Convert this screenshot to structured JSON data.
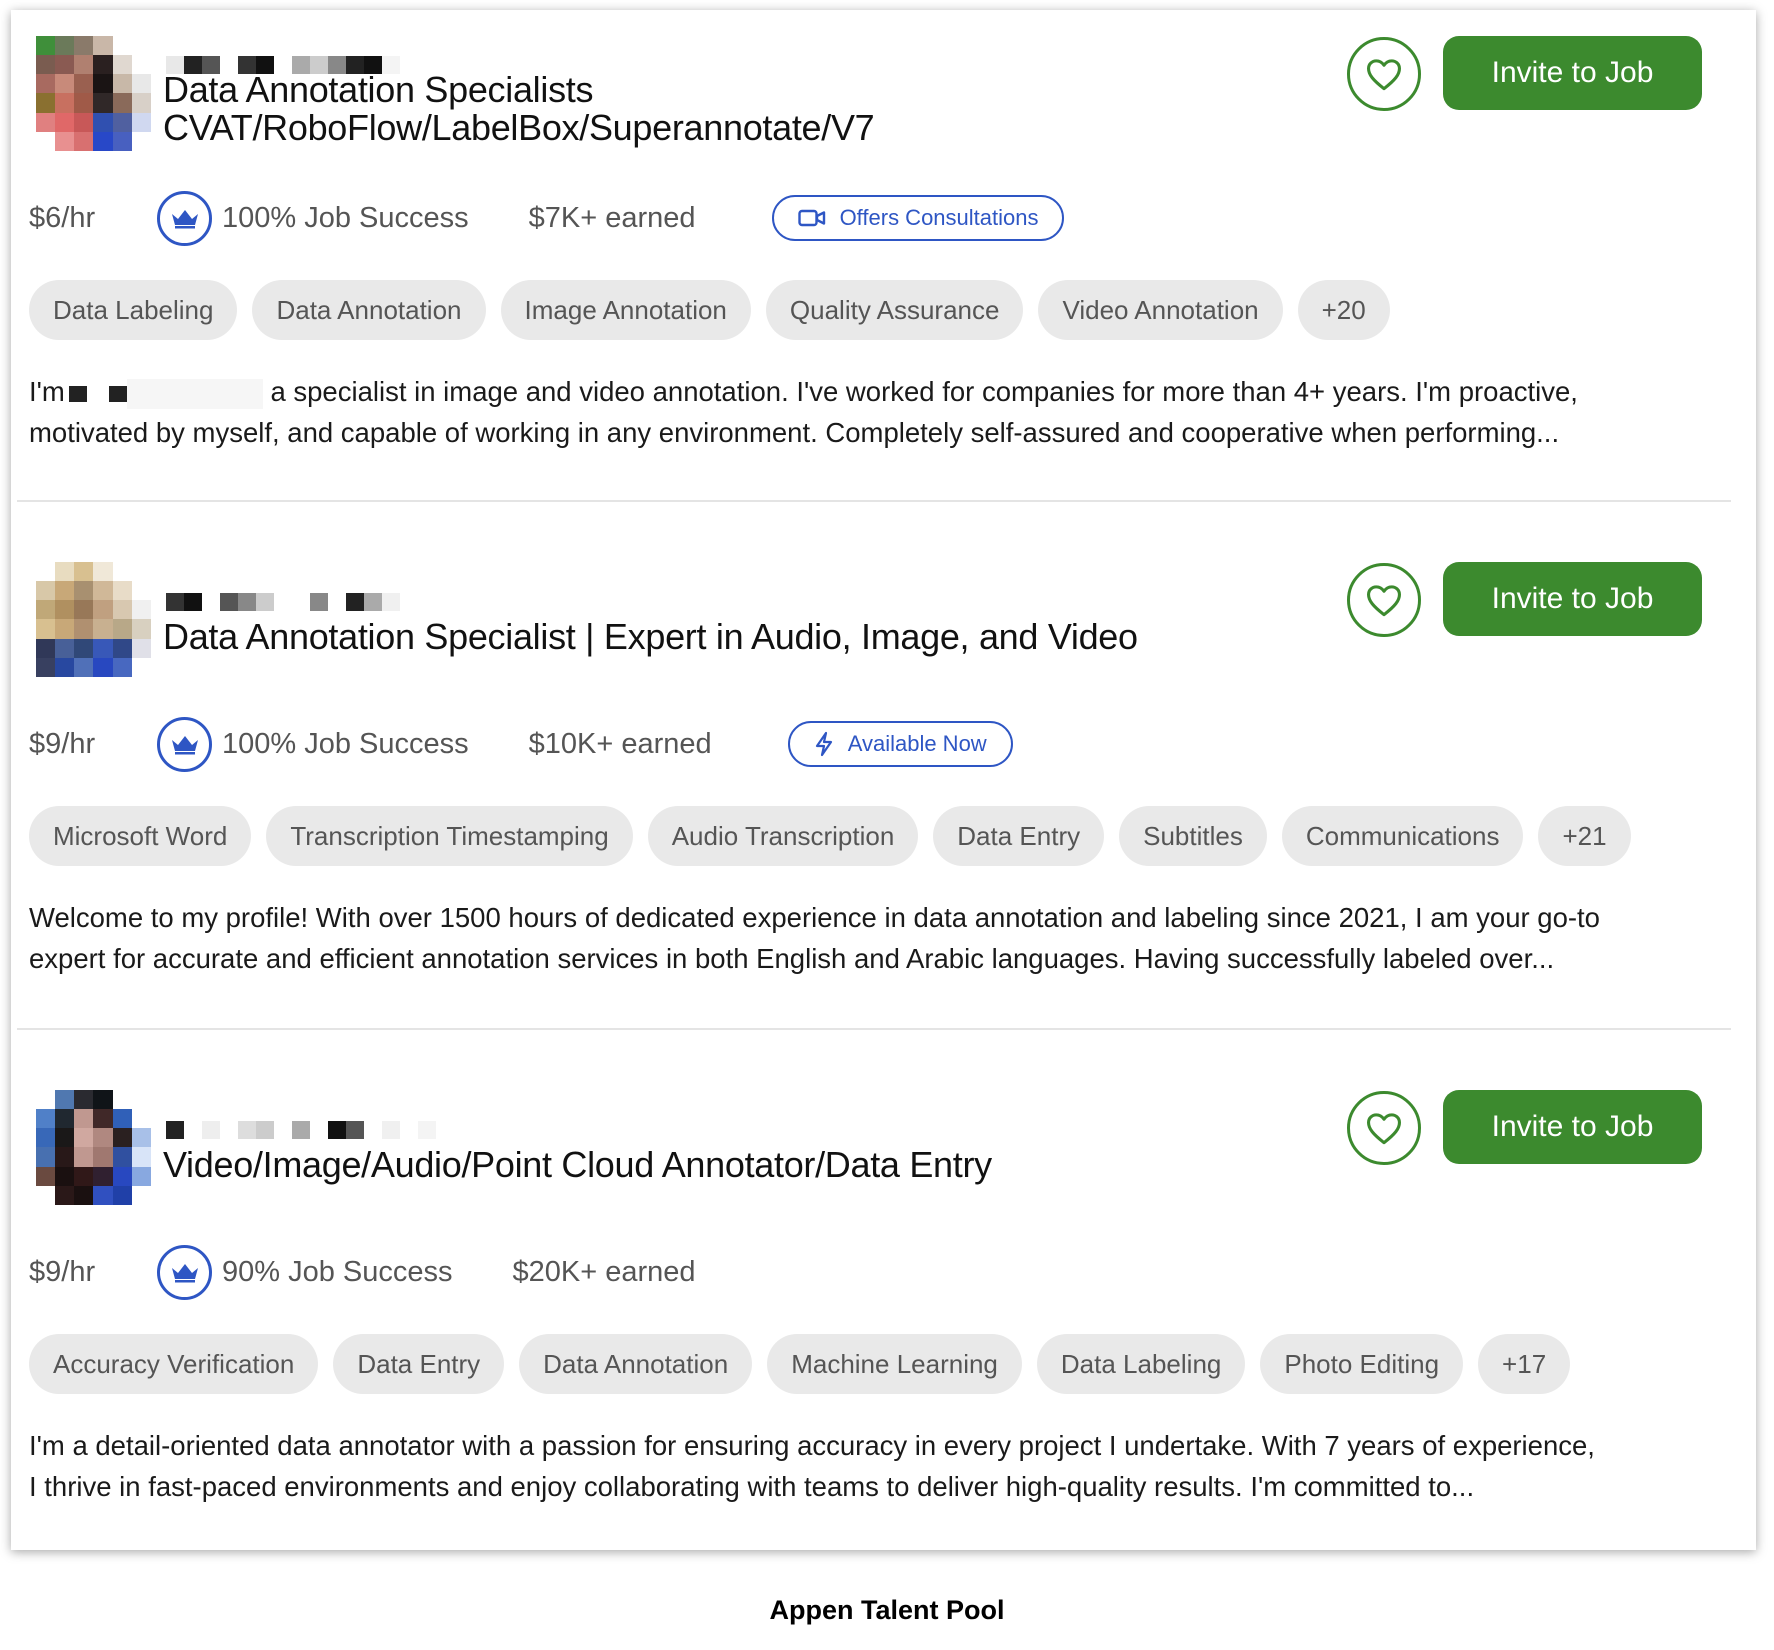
{
  "caption": "Appen Talent Pool",
  "colors": {
    "accent_green": "#3c8a2e",
    "badge_blue": "#2e56c4",
    "skill_bg": "#e9e9e9"
  },
  "cards": [
    {
      "title_line1": "Data Annotation Specialists",
      "title_line2": "CVAT/RoboFlow/LabelBox/Superannotate/V7",
      "invite_label": "Invite to Job",
      "favorite_icon": "heart-icon",
      "rate": "$6/hr",
      "job_success": "100% Job Success",
      "earned": "$7K+ earned",
      "extra_badge": {
        "icon": "video-camera-icon",
        "label": "Offers Consultations"
      },
      "skills": [
        "Data Labeling",
        "Data Annotation",
        "Image Annotation",
        "Quality Assurance",
        "Video Annotation",
        "+20"
      ],
      "bio_prefix": "I'm",
      "bio_line1": "a specialist in image and video annotation. I've worked for companies for more than 4+ years. I'm proactive,",
      "bio_line2": "motivated by myself, and capable of working in any environment. Completely self-assured and cooperative when performing..."
    },
    {
      "title_line1": "Data Annotation Specialist | Expert in Audio, Image, and Video",
      "invite_label": "Invite to Job",
      "favorite_icon": "heart-icon",
      "rate": "$9/hr",
      "job_success": "100% Job Success",
      "earned": "$10K+ earned",
      "extra_badge": {
        "icon": "lightning-icon",
        "label": "Available Now"
      },
      "skills": [
        "Microsoft Word",
        "Transcription Timestamping",
        "Audio Transcription",
        "Data Entry",
        "Subtitles",
        "Communications",
        "+21"
      ],
      "bio_line1": "Welcome to my profile! With over 1500 hours of dedicated experience in data annotation and labeling since 2021, I am your go-to",
      "bio_line2": "expert for accurate and efficient annotation services in both English and Arabic languages. Having successfully labeled over..."
    },
    {
      "title_line1": "Video/Image/Audio/Point Cloud Annotator/Data Entry",
      "invite_label": "Invite to Job",
      "favorite_icon": "heart-icon",
      "rate": "$9/hr",
      "job_success": "90% Job Success",
      "earned": "$20K+ earned",
      "skills": [
        "Accuracy Verification",
        "Data Entry",
        "Data Annotation",
        "Machine Learning",
        "Data Labeling",
        "Photo Editing",
        "+17"
      ],
      "bio_line1": "I'm a detail-oriented data annotator with a passion for ensuring accuracy in every project I undertake. With 7 years of experience,",
      "bio_line2": "I thrive in fast-paced environments and enjoy collaborating with teams to deliver high-quality results. I'm committed to..."
    }
  ]
}
